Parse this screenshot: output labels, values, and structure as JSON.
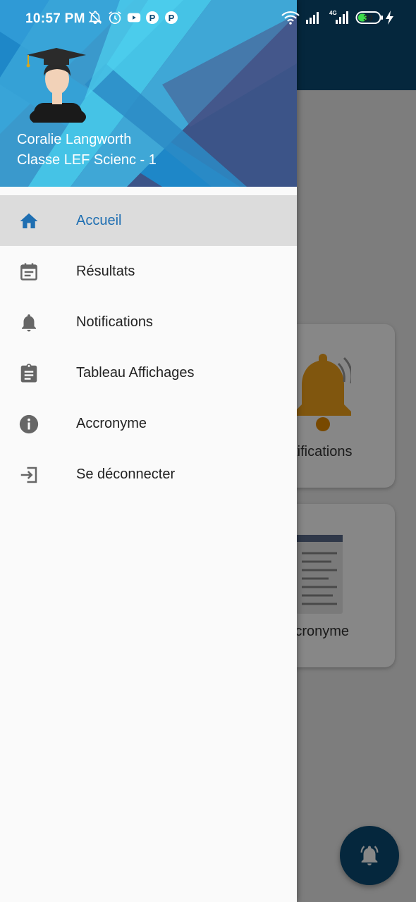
{
  "status_bar": {
    "time": "10:57 PM",
    "battery": "39",
    "icons": [
      "mute-bell-icon",
      "alarm-icon",
      "youtube-icon",
      "p-app-icon",
      "p-app-icon",
      "wifi-icon",
      "signal-icon",
      "4g-signal-icon",
      "battery-icon",
      "charging-icon"
    ]
  },
  "drawer": {
    "user": {
      "name": "Coralie Langworth",
      "class": "Classe LEF Scienc - 1"
    },
    "menu": [
      {
        "label": "Accueil",
        "icon": "home-icon",
        "active": true
      },
      {
        "label": "Résultats",
        "icon": "calendar-icon",
        "active": false
      },
      {
        "label": "Notifications",
        "icon": "bell-icon",
        "active": false
      },
      {
        "label": "Tableau Affichages",
        "icon": "clipboard-icon",
        "active": false
      },
      {
        "label": "Accronyme",
        "icon": "info-icon",
        "active": false
      },
      {
        "label": "Se déconnecter",
        "icon": "logout-icon",
        "active": false
      }
    ]
  },
  "background": {
    "cards": [
      {
        "label": "Notifications",
        "icon": "bell-icon"
      },
      {
        "label": "Accronyme",
        "icon": "notepad-icon"
      }
    ],
    "fab_icon": "bell-ringing-icon"
  },
  "colors": {
    "accent": "#1f6fb2",
    "app_bar": "#0b4a74",
    "active_item_bg": "#dcdcdc"
  }
}
